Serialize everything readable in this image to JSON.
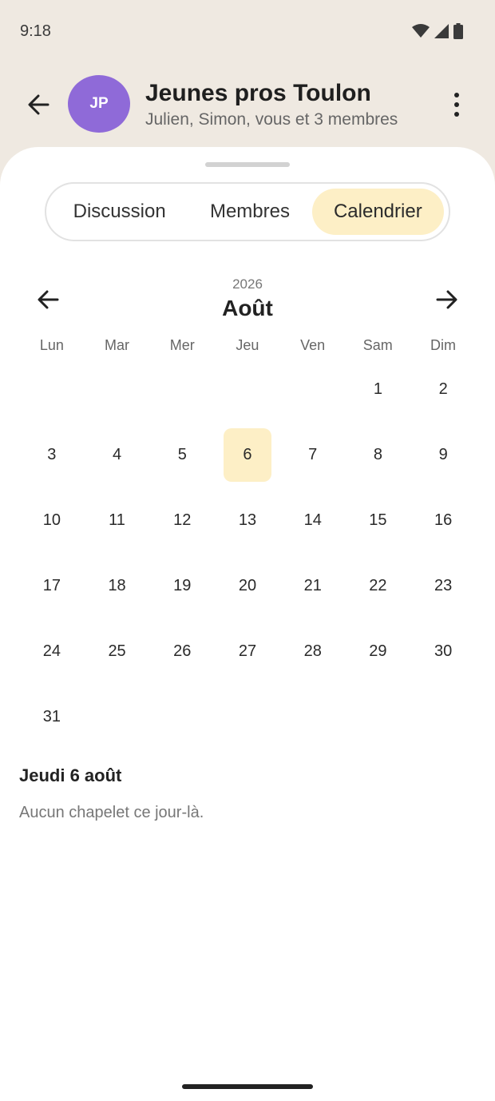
{
  "status_bar": {
    "time": "9:18",
    "icons": [
      "wifi-icon",
      "signal-icon",
      "battery-icon"
    ]
  },
  "header": {
    "avatar_initials": "JP",
    "title": "Jeunes pros Toulon",
    "subtitle": "Julien, Simon, vous et 3 membres"
  },
  "tabs": [
    {
      "label": "Discussion",
      "active": false
    },
    {
      "label": "Membres",
      "active": false
    },
    {
      "label": "Calendrier",
      "active": true
    }
  ],
  "calendar": {
    "year": "2026",
    "month": "Août",
    "weekdays": [
      "Lun",
      "Mar",
      "Mer",
      "Jeu",
      "Ven",
      "Sam",
      "Dim"
    ],
    "days": [
      "",
      "",
      "",
      "",
      "",
      "1",
      "2",
      "3",
      "4",
      "5",
      "6",
      "7",
      "8",
      "9",
      "10",
      "11",
      "12",
      "13",
      "14",
      "15",
      "16",
      "17",
      "18",
      "19",
      "20",
      "21",
      "22",
      "23",
      "24",
      "25",
      "26",
      "27",
      "28",
      "29",
      "30",
      "31"
    ],
    "selected_day": "6"
  },
  "selected": {
    "date_label": "Jeudi 6 août",
    "empty_message": "Aucun chapelet ce jour-là."
  },
  "colors": {
    "background": "#efe9e1",
    "avatar": "#8f6ad8",
    "accent": "#fdefc6"
  }
}
